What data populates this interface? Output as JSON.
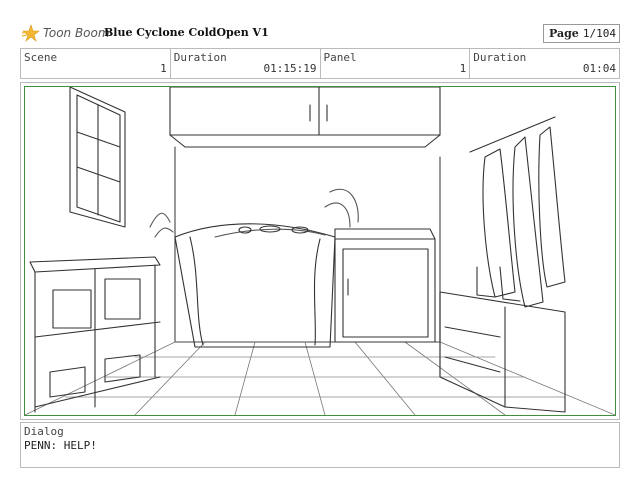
{
  "header": {
    "logo_text": "Toon Boom",
    "project_title": "Blue Cyclone ColdOpen V1",
    "page_label": "Page",
    "page_value": "1/104"
  },
  "info": {
    "scene_label": "Scene",
    "scene_value": "1",
    "scene_duration_label": "Duration",
    "scene_duration_value": "01:15:19",
    "panel_label": "Panel",
    "panel_value": "1",
    "panel_duration_label": "Duration",
    "panel_duration_value": "01:04"
  },
  "dialog": {
    "label": "Dialog",
    "text": "PENN: HELP!"
  },
  "colors": {
    "panel_border": "#3f8f3f",
    "logo_accent": "#f2b632"
  }
}
